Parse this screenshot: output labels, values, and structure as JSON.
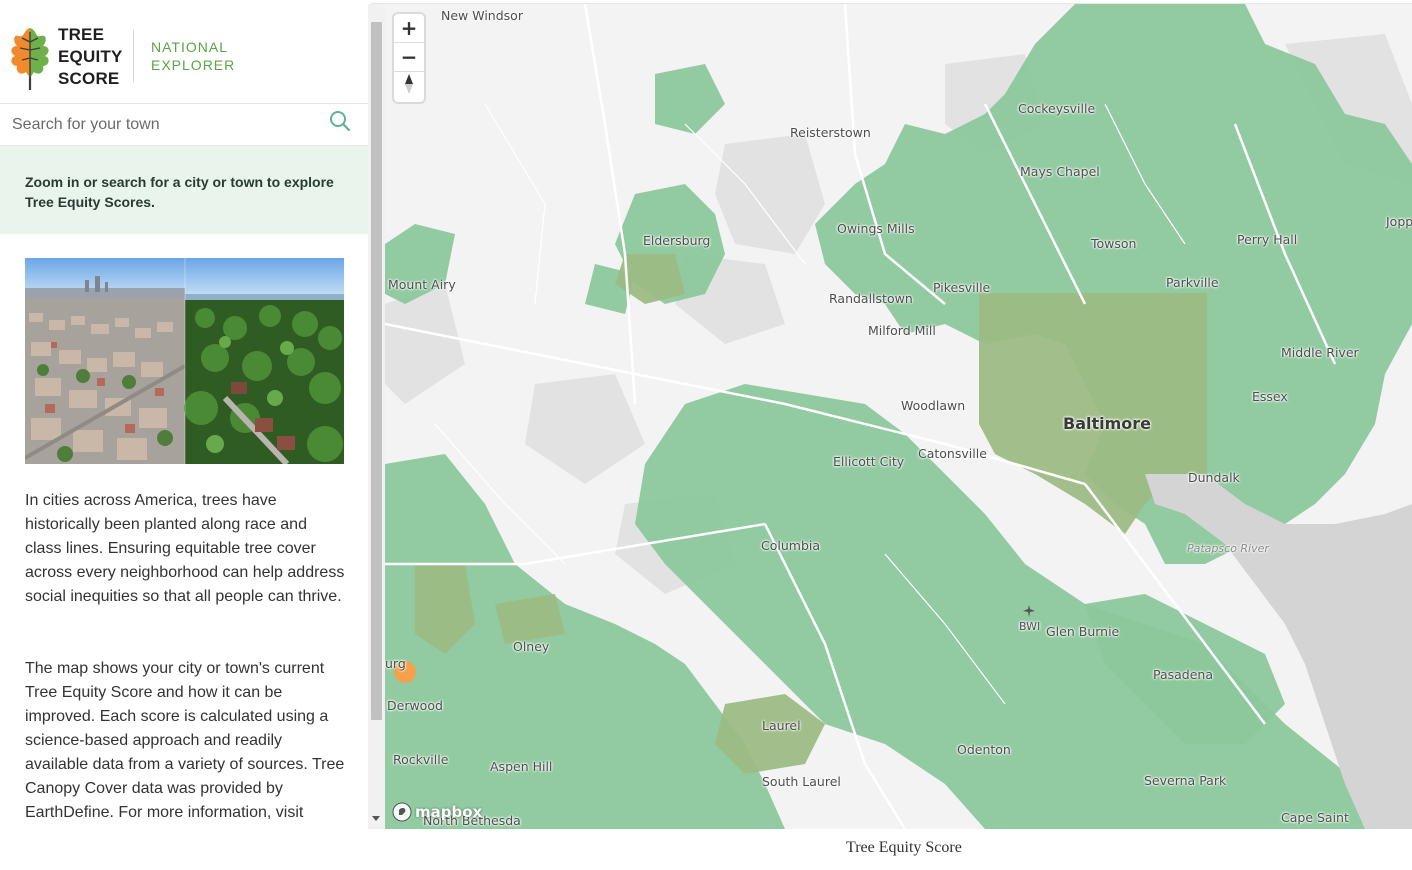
{
  "brand": {
    "logo_lines": [
      "TREE",
      "EQUITY",
      "SCORE"
    ],
    "subtitle_lines": [
      "NATIONAL",
      "EXPLORER"
    ]
  },
  "search": {
    "placeholder": "Search for your town",
    "icon": "search-icon"
  },
  "notice": {
    "text": "Zoom in or search for a city or town to explore Tree Equity Scores."
  },
  "body": {
    "paragraph1": "In cities across America, trees have historically been planted along race and class lines. Ensuring equitable tree cover across every neighborhood can help address social inequities so that all people can thrive.",
    "paragraph2": "The map shows your city or town's current Tree Equity Score and how it can be improved. Each score is calculated using a science-based approach and readily available data from a variety of sources. Tree Canopy Cover data was provided by EarthDefine. For more information, visit"
  },
  "map": {
    "controls": {
      "zoom_in": "+",
      "zoom_out": "−",
      "compass": "▲"
    },
    "attribution": "mapbox",
    "labels": {
      "new_windsor": "New Windsor",
      "reisterstown": "Reisterstown",
      "cockeysville": "Cockeysville",
      "mays_chapel": "Mays Chapel",
      "eldersburg": "Eldersburg",
      "owings_mills": "Owings Mills",
      "towson": "Towson",
      "perry_hall": "Perry Hall",
      "joppa": "Jopp",
      "mount_airy": "Mount Airy",
      "randallstown": "Randallstown",
      "pikesville": "Pikesville",
      "parkville": "Parkville",
      "milford_mill": "Milford Mill",
      "middle_river": "Middle River",
      "essex": "Essex",
      "woodlawn": "Woodlawn",
      "baltimore": "Baltimore",
      "ellicott_city": "Ellicott City",
      "catonsville": "Catonsville",
      "dundalk": "Dundalk",
      "columbia": "Columbia",
      "patapsco_river": "Patapsco River",
      "bwi": "BWI",
      "glen_burnie": "Glen Burnie",
      "olney": "Olney",
      "gaithersburg_partial": "urg",
      "derwood": "Derwood",
      "pasadena": "Pasadena",
      "laurel": "Laurel",
      "odenton": "Odenton",
      "rockville": "Rockville",
      "aspen_hill": "Aspen Hill",
      "south_laurel": "South Laurel",
      "severna_park": "Severna Park",
      "north_bethesda": "North Bethesda",
      "cape_saint": "Cape Saint"
    },
    "colors": {
      "base": "#f3f3f3",
      "high_score_green": "#8cc79c",
      "mid_score_green": "#9dbb85",
      "low_score_orange": "#f5a04a",
      "water": "#d4d4d4",
      "urban": "#e3e3e3"
    }
  },
  "caption": "Tree Equity Score"
}
